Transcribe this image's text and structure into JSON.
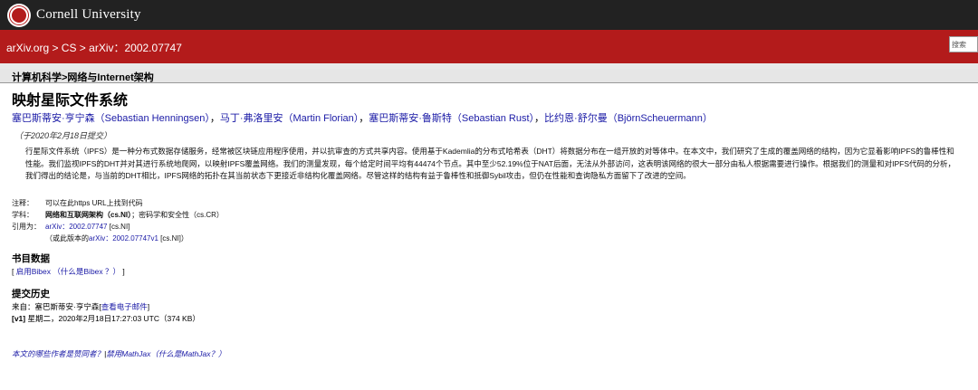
{
  "header": {
    "university": "Cornell University",
    "breadcrumb": "arXiv.org > CS > arXiv：2002.07747",
    "search_placeholder": "搜索"
  },
  "subject_bar": "计算机科学>网络与Internet架构",
  "paper": {
    "title": "映射星际文件系统",
    "authors": [
      "塞巴斯蒂安·亨宁森（Sebastian Henningsen）",
      "马丁·弗洛里安（Martin Florian）",
      "塞巴斯蒂安·鲁斯特（Sebastian Rust）",
      "比约恩·舒尔曼（BjörnScheuermann）"
    ],
    "separator": "，",
    "submitted": "（于2020年2月18日提交）",
    "abstract": "行星际文件系统（IPFS）是一种分布式数据存储服务，经常被区块链应用程序使用，并以抗审查的方式共享内容。使用基于Kademlia的分布式哈希表（DHT）将数据分布在一组开放的对等体中。在本文中，我们研究了生成的覆盖网络的结构，因为它显着影响IPFS的鲁棒性和性能。我们监视IPFS的DHT并对其进行系统地爬网，以映射IPFS覆盖网络。我们的测量发现，每个给定时间平均有44474个节点。其中至少52.19%位于NAT后面，无法从外部访问，这表明该网络的很大一部分由私人根据需要进行操作。根据我们的测量和对IPFS代码的分析，我们得出的结论是，与当前的DHT相比，IPFS网络的拓扑在其当前状态下更接近非结构化覆盖网络。尽管这样的结构有益于鲁棒性和抵御Sybil攻击，但仍在性能和查询隐私方面留下了改进的空间。"
  },
  "metadata": {
    "comment_label": "注释：",
    "comment_text": "可以在此https URL上找到代码",
    "subjects_label": "学科：",
    "subjects_primary": "网络和互联网架构（cs.NI）",
    "subjects_rest": "；密码学和安全性（cs.CR）",
    "cite_label": "引用为：",
    "cite_id": "arXiv：2002.07747",
    "cite_cat": " [cs.NI]",
    "cite_version_prefix": "（或此版本的",
    "cite_version_link": "arXiv：2002.07747v1",
    "cite_version_suffix": " [cs.NI]）"
  },
  "bib": {
    "heading": "书目数据",
    "open": "[",
    "enable_link": "启用Bibex",
    "what_link": "（什么是Bibex ？）",
    "close": "]"
  },
  "history": {
    "heading": "提交历史",
    "from_text": "来自：塞巴斯蒂安·亨宁森[",
    "email_link": "查看电子邮件",
    "from_close": "]",
    "version_tag": "[v1]",
    "version_text": " 星期二，2020年2月18日17:27:03 UTC（374 KB）"
  },
  "footer": {
    "endorsers_link": "本文的哪些作者是赞同者？",
    "sep": "|",
    "mathjax_link": "禁用MathJax（什么是MathJax？）"
  },
  "colors": {
    "top_bar": "#222222",
    "red_bar": "#b31b1b",
    "link": "#1a1aa6"
  }
}
